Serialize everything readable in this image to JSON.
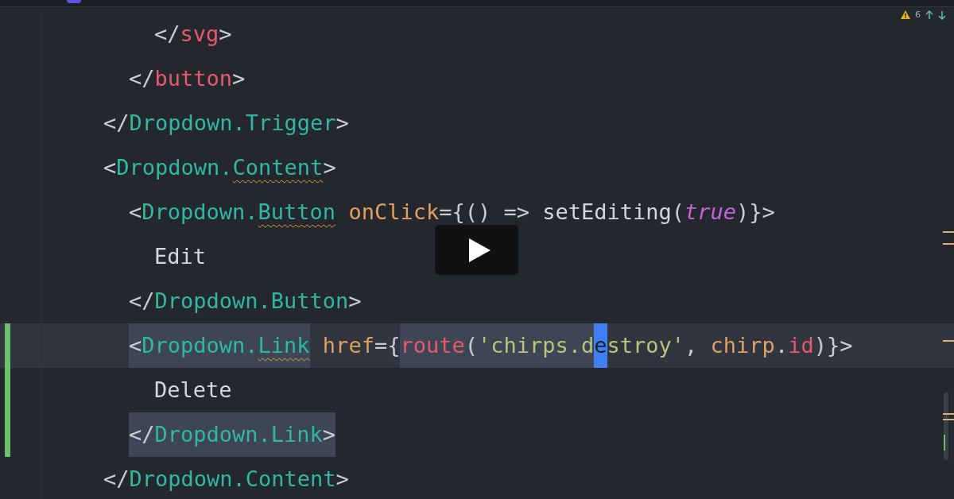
{
  "problems": {
    "count": "6"
  },
  "editor": {
    "lines": [
      {
        "children": [
          {
            "children": [
              {
                "active": false,
                "changed": false,
                "tokens": [
                  {
                    "text": "</",
                    "kind": "punct",
                    "warn": false,
                    "highlighted": false
                  },
                  {
                    "text": "svg",
                    "kind": "tag",
                    "warn": false,
                    "highlighted": false
                  },
                  {
                    "text": ">",
                    "kind": "punct",
                    "warn": false,
                    "highlighted": false
                  }
                ]
              }
            ]
          },
          {
            "active": false,
            "changed": false,
            "tokens": [
              {
                "text": "</",
                "kind": "punct",
                "warn": false,
                "highlighted": false
              },
              {
                "text": "button",
                "kind": "tag",
                "warn": false,
                "highlighted": false
              },
              {
                "text": ">",
                "kind": "punct",
                "warn": false,
                "highlighted": false
              }
            ]
          }
        ]
      },
      {
        "active": false,
        "changed": false,
        "tokens": [
          {
            "text": "</",
            "kind": "punct",
            "warn": false,
            "highlighted": false
          },
          {
            "text": "Dropdown.Trigger",
            "kind": "component",
            "warn": false,
            "highlighted": false
          },
          {
            "text": ">",
            "kind": "punct",
            "warn": false,
            "highlighted": false
          }
        ]
      },
      {
        "active": false,
        "changed": false,
        "tokens": [
          {
            "text": "<",
            "kind": "punct",
            "warn": false,
            "highlighted": false
          },
          {
            "text": "Dropdown.",
            "kind": "component",
            "warn": false,
            "highlighted": false
          },
          {
            "text": "Content",
            "kind": "component",
            "warn": true,
            "highlighted": false
          },
          {
            "text": ">",
            "kind": "punct",
            "warn": false,
            "highlighted": false
          }
        ],
        "children": [
          {
            "active": false,
            "changed": false,
            "tokens": [
              {
                "text": "<",
                "kind": "punct",
                "warn": false,
                "highlighted": false
              },
              {
                "text": "Dropdown.",
                "kind": "component",
                "warn": false,
                "highlighted": false
              },
              {
                "text": "Button",
                "kind": "component",
                "warn": true,
                "highlighted": false
              },
              {
                "text": " onClick",
                "kind": "attr",
                "warn": false,
                "highlighted": false
              },
              {
                "text": "={() => ",
                "kind": "punct",
                "warn": false,
                "highlighted": false
              },
              {
                "text": "setEditing",
                "kind": "plain",
                "warn": false,
                "highlighted": false
              },
              {
                "text": "(",
                "kind": "punct",
                "warn": false,
                "highlighted": false
              },
              {
                "text": "true",
                "kind": "keyword",
                "warn": false,
                "highlighted": false
              },
              {
                "text": ")}>",
                "kind": "punct",
                "warn": false,
                "highlighted": false
              }
            ],
            "children": [
              {
                "active": false,
                "changed": false,
                "tokens": [
                  {
                    "text": "Edit",
                    "kind": "plain",
                    "warn": false,
                    "highlighted": false
                  }
                ]
              }
            ]
          },
          {
            "active": false,
            "changed": false,
            "tokens": [
              {
                "text": "</",
                "kind": "punct",
                "warn": false,
                "highlighted": false
              },
              {
                "text": "Dropdown.Button",
                "kind": "component",
                "warn": false,
                "highlighted": false
              },
              {
                "text": ">",
                "kind": "punct",
                "warn": false,
                "highlighted": false
              }
            ]
          },
          {
            "active": true,
            "changed": true,
            "tokens": [
              {
                "text": "<",
                "kind": "punct",
                "warn": false,
                "highlighted": true
              },
              {
                "text": "Dropdown.",
                "kind": "component",
                "warn": false,
                "highlighted": true
              },
              {
                "text": "Link",
                "kind": "component",
                "warn": true,
                "highlighted": true
              },
              {
                "text": " href",
                "kind": "attr",
                "warn": false,
                "highlighted": false
              },
              {
                "text": "={",
                "kind": "punct",
                "warn": false,
                "highlighted": false
              },
              {
                "text": "route",
                "kind": "function",
                "warn": false,
                "highlighted": true
              },
              {
                "text": "(",
                "kind": "punct",
                "warn": false,
                "highlighted": true
              },
              {
                "text": "'chirps.d",
                "kind": "string",
                "warn": false,
                "highlighted": true
              },
              {
                "text": "e",
                "kind": "cursor",
                "warn": false
              },
              {
                "text": "stroy'",
                "kind": "string",
                "warn": false,
                "highlighted": false
              },
              {
                "text": ", ",
                "kind": "punct",
                "warn": false,
                "highlighted": false
              },
              {
                "text": "chirp",
                "kind": "attr",
                "warn": false,
                "highlighted": false
              },
              {
                "text": ".",
                "kind": "punct",
                "warn": false,
                "highlighted": false
              },
              {
                "text": "id",
                "kind": "function",
                "warn": false,
                "highlighted": false
              },
              {
                "text": ")}>",
                "kind": "punct",
                "warn": false,
                "highlighted": false
              }
            ],
            "children": [
              {
                "active": false,
                "changed": true,
                "tokens": [
                  {
                    "text": "Delete",
                    "kind": "plain",
                    "warn": false,
                    "highlighted": false
                  }
                ]
              }
            ]
          },
          {
            "active": false,
            "changed": true,
            "tokens": [
              {
                "text": "</",
                "kind": "punct",
                "warn": false,
                "highlighted": true
              },
              {
                "text": "Dropdown.Link",
                "kind": "component",
                "warn": false,
                "highlighted": true
              },
              {
                "text": ">",
                "kind": "punct",
                "warn": false,
                "highlighted": true
              }
            ]
          }
        ]
      },
      {
        "active": false,
        "changed": false,
        "tokens": [
          {
            "text": "</",
            "kind": "punct",
            "warn": false,
            "highlighted": false
          },
          {
            "text": "Dropdown.Content",
            "kind": "component",
            "warn": false,
            "highlighted": false
          },
          {
            "text": ">",
            "kind": "punct",
            "warn": false,
            "highlighted": false
          }
        ]
      }
    ]
  }
}
